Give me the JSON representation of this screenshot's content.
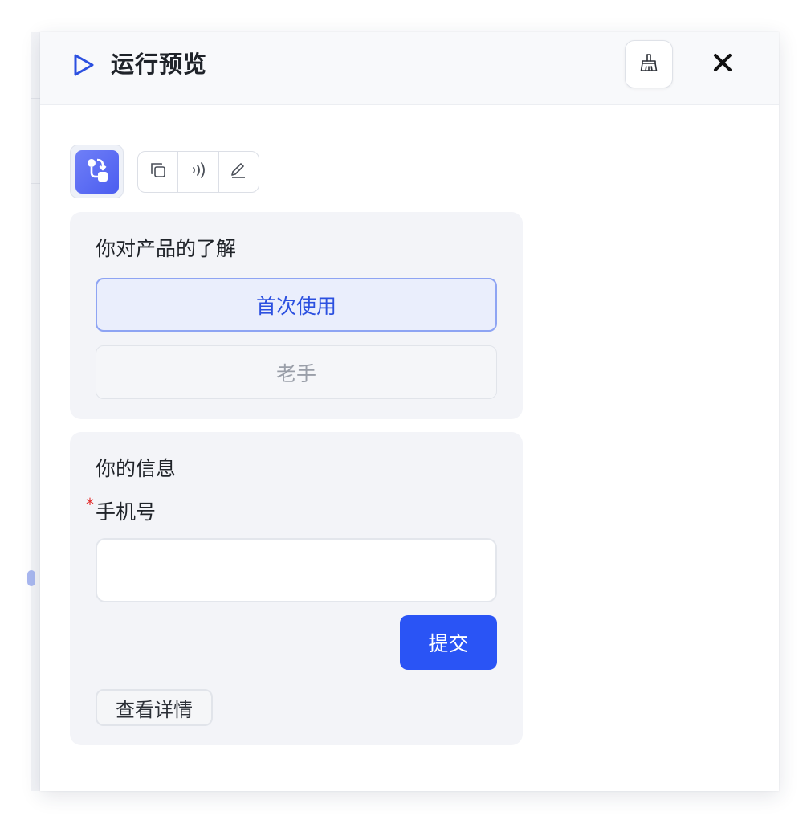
{
  "header": {
    "title": "运行预览",
    "title_icon": "play-icon",
    "clean_icon": "broom-icon",
    "close_icon": "close-icon"
  },
  "toolbar": {
    "avatar_icon": "workflow-icon",
    "tools": [
      "copy-icon",
      "voice-icon",
      "edit-icon"
    ]
  },
  "question_card": {
    "title": "你对产品的了解",
    "options": [
      {
        "label": "首次使用",
        "selected": true
      },
      {
        "label": "老手",
        "selected": false
      }
    ]
  },
  "info_card": {
    "title": "你的信息",
    "required_mark": "*",
    "phone_label": "手机号",
    "phone_value": "",
    "submit_label": "提交",
    "detail_label": "查看详情"
  },
  "colors": {
    "accent": "#2a54f5",
    "selected_text": "#2c50e0",
    "required": "#e22d2d"
  }
}
